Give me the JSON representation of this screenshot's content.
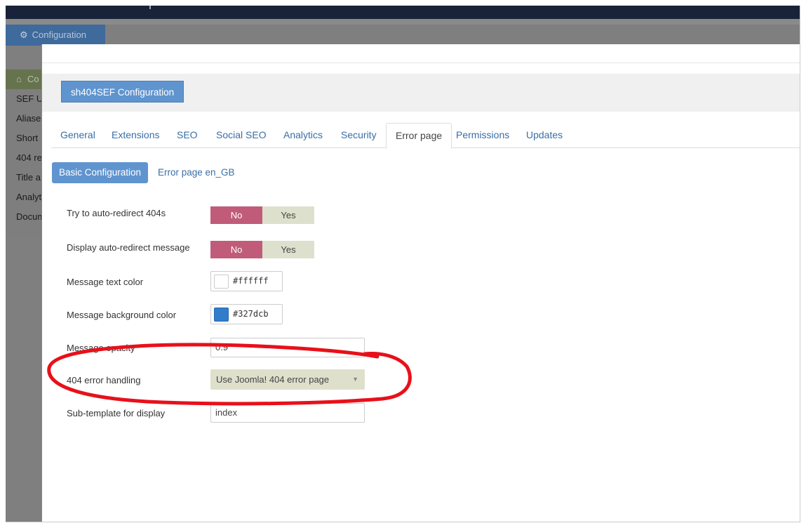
{
  "app": {
    "config_tab_label": "Configuration",
    "side_menu": [
      "Co",
      "SEF U",
      "Aliase",
      "Short",
      "404 re",
      "Title a",
      "Analyt",
      "Docum"
    ]
  },
  "modal": {
    "title_button": "sh404SEF Configuration",
    "tabs": [
      {
        "label": "General",
        "active": false
      },
      {
        "label": "Extensions",
        "active": false
      },
      {
        "label": "SEO",
        "active": false
      },
      {
        "label": "Social SEO",
        "active": false
      },
      {
        "label": "Analytics",
        "active": false
      },
      {
        "label": "Security",
        "active": false
      },
      {
        "label": "Error page",
        "active": true
      },
      {
        "label": "Permissions",
        "active": false
      },
      {
        "label": "Updates",
        "active": false
      }
    ],
    "subtabs": {
      "active": "Basic Configuration",
      "other": "Error page en_GB"
    },
    "fields": {
      "auto_redirect": {
        "label": "Try to auto-redirect 404s",
        "no": "No",
        "yes": "Yes",
        "value": "No"
      },
      "display_message": {
        "label": "Display auto-redirect message",
        "no": "No",
        "yes": "Yes",
        "value": "No"
      },
      "text_color": {
        "label": "Message text color",
        "value": "#ffffff"
      },
      "bg_color": {
        "label": "Message background color",
        "value": "#327dcb"
      },
      "opacity": {
        "label": "Message opacity",
        "value": "0.9"
      },
      "error_handling": {
        "label": "404 error handling",
        "value": "Use Joomla! 404 error page"
      },
      "subtemplate": {
        "label": "Sub-template for display",
        "value": "index"
      }
    }
  },
  "colors": {
    "accent": "#5f94cf",
    "toggle_no": "#c05c7a",
    "toggle_yes": "#dde0cc",
    "annotation": "#e8101a"
  },
  "icons": {
    "config_tab": "gear-icon",
    "side_active": "home-icon",
    "select": "caret-down-icon"
  }
}
